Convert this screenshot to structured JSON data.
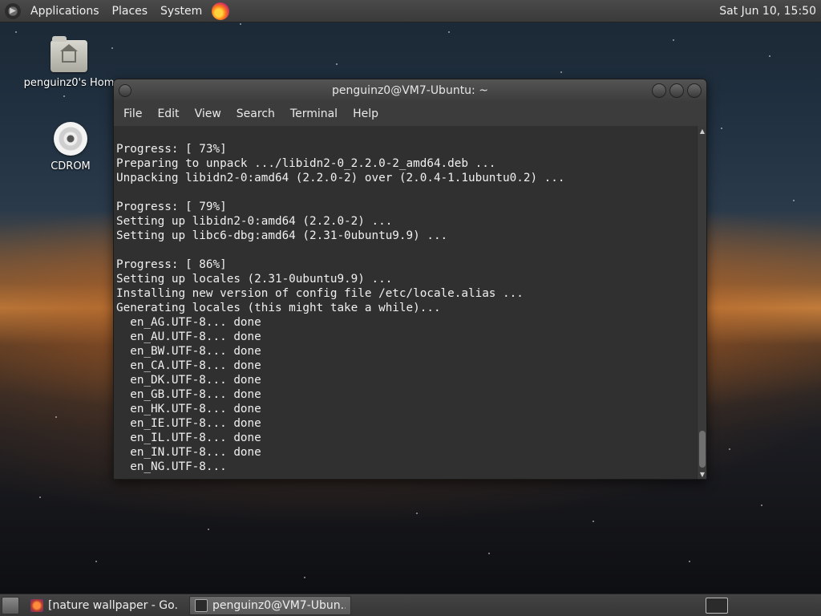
{
  "top_panel": {
    "menus": [
      "Applications",
      "Places",
      "System"
    ],
    "clock": "Sat Jun 10, 15:50"
  },
  "desktop_icons": [
    {
      "label": "penguinz0's Hom",
      "icon": "home-folder-icon"
    },
    {
      "label": "CDROM",
      "icon": "cdrom-icon"
    }
  ],
  "terminal": {
    "title": "penguinz0@VM7-Ubuntu: ~",
    "menu": [
      "File",
      "Edit",
      "View",
      "Search",
      "Terminal",
      "Help"
    ],
    "lines": [
      "Progress: [ 73%]",
      "Preparing to unpack .../libidn2-0_2.2.0-2_amd64.deb ...",
      "Unpacking libidn2-0:amd64 (2.2.0-2) over (2.0.4-1.1ubuntu0.2) ...",
      "",
      "Progress: [ 79%]",
      "Setting up libidn2-0:amd64 (2.2.0-2) ...",
      "Setting up libc6-dbg:amd64 (2.31-0ubuntu9.9) ...",
      "",
      "Progress: [ 86%]",
      "Setting up locales (2.31-0ubuntu9.9) ...",
      "Installing new version of config file /etc/locale.alias ...",
      "Generating locales (this might take a while)...",
      "  en_AG.UTF-8... done",
      "  en_AU.UTF-8... done",
      "  en_BW.UTF-8... done",
      "  en_CA.UTF-8... done",
      "  en_DK.UTF-8... done",
      "  en_GB.UTF-8... done",
      "  en_HK.UTF-8... done",
      "  en_IE.UTF-8... done",
      "  en_IL.UTF-8... done",
      "  en_IN.UTF-8... done",
      "  en_NG.UTF-8..."
    ]
  },
  "taskbar": {
    "tasks": [
      {
        "label": "[nature wallpaper - Go...",
        "icon": "browser-icon",
        "active": false
      },
      {
        "label": "penguinz0@VM7-Ubun...",
        "icon": "terminal-icon",
        "active": true
      }
    ]
  }
}
